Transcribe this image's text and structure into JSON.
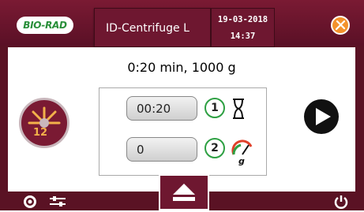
{
  "header": {
    "logo_text": "BIO-RAD",
    "device_name": "ID-Centrifuge L",
    "date": "19-03-2018",
    "time": "14:37"
  },
  "summary": "0:20 min, 1000 g",
  "rotor": {
    "capacity_label": "12"
  },
  "program": {
    "time_value": "00:20",
    "speed_value": "0",
    "step1_label": "1",
    "step2_label": "2",
    "speed_unit": "g"
  },
  "icons": {
    "tools": "tools-icon",
    "hourglass": "hourglass-icon",
    "speed_gauge": "gauge-icon",
    "play": "play-icon",
    "settings": "gear-icon",
    "filters": "sliders-icon",
    "eject": "eject-icon",
    "power": "power-icon"
  },
  "colors": {
    "header_bg": "#6e1730",
    "accent_green": "#2ea043",
    "tools_orange": "#f3922c"
  }
}
